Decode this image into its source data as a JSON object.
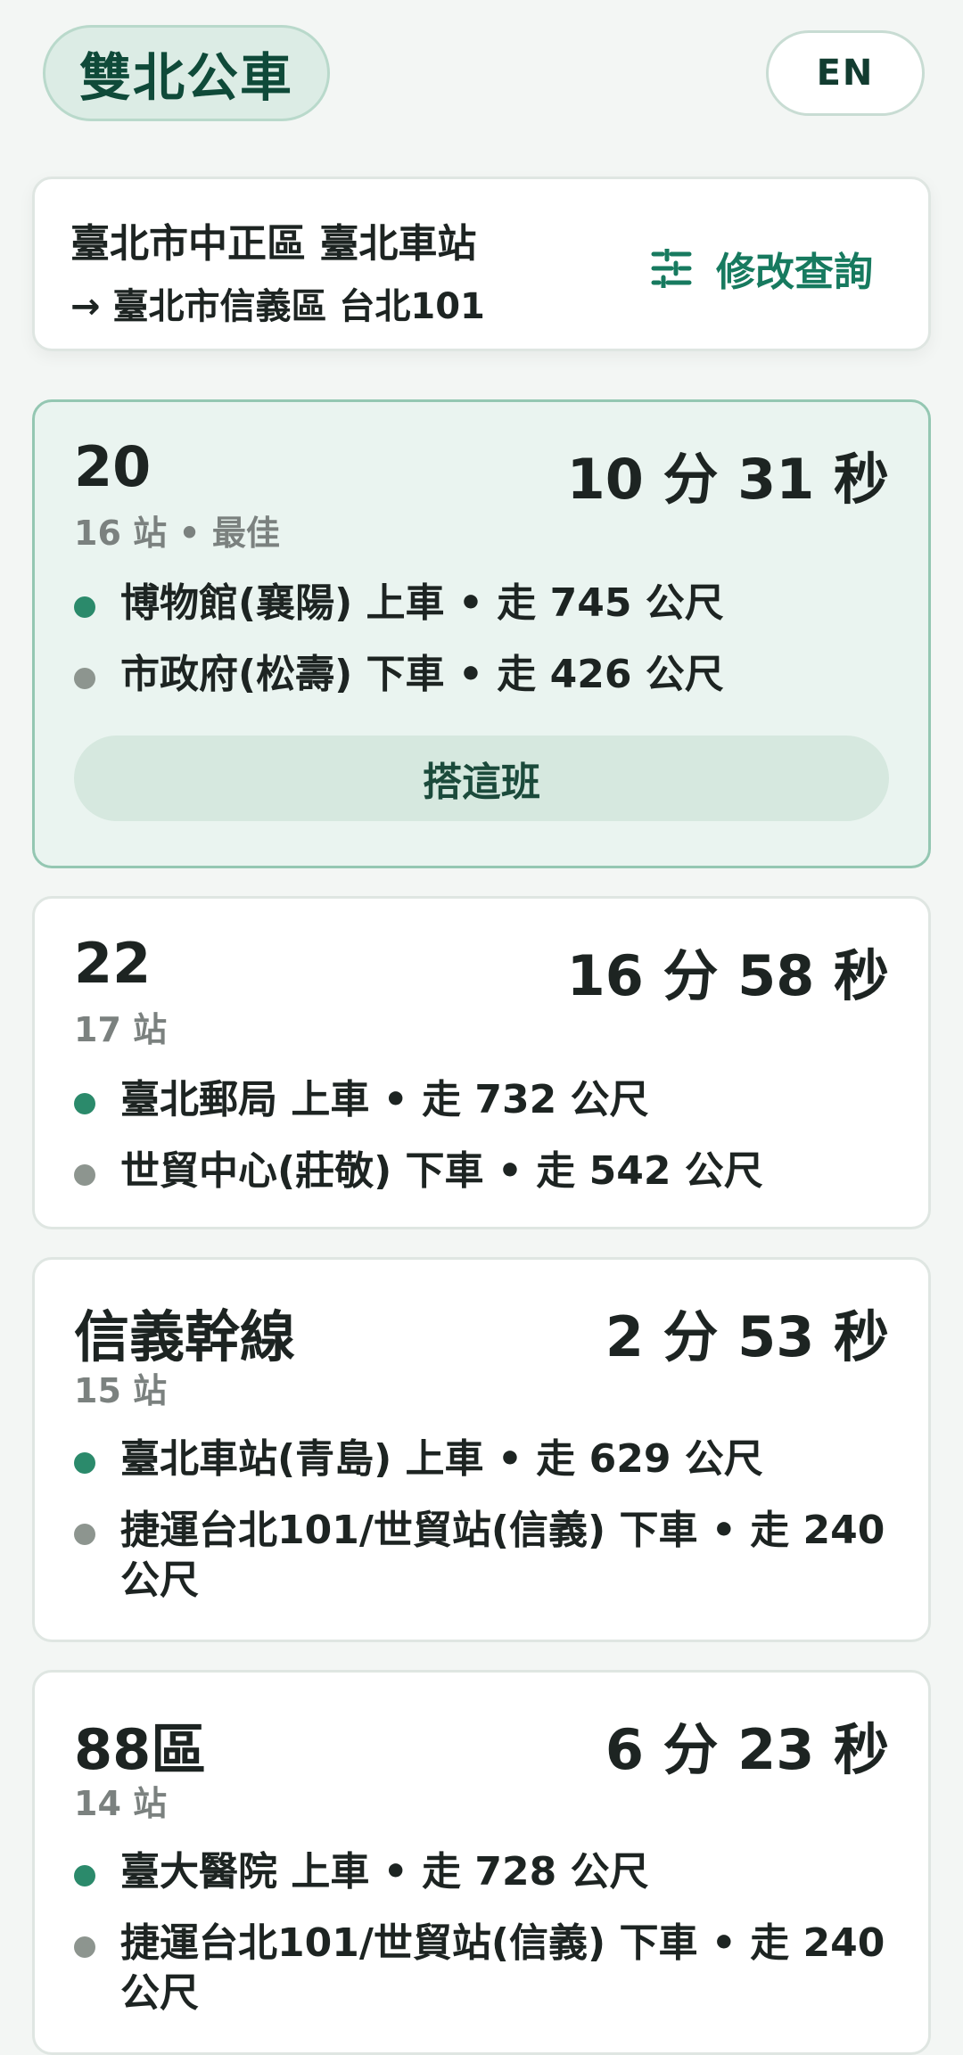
{
  "header": {
    "app_title": "雙北公車",
    "lang_button": "EN"
  },
  "query": {
    "from": "臺北市中正區 臺北車站",
    "to": "→ 臺北市信義區 台北101",
    "edit_label": "修改查詢",
    "edit_icon": "sliders-icon"
  },
  "routes": [
    {
      "number": "20",
      "time": "10 分 31 秒",
      "meta": "16 站 • 最佳",
      "board": "博物館(襄陽) 上車 • 走 745 公尺",
      "alight": "市政府(松壽) 下車 • 走 426 公尺",
      "action": "搭這班"
    },
    {
      "number": "22",
      "time": "16 分 58 秒",
      "meta": "17 站",
      "board": "臺北郵局 上車 • 走 732 公尺",
      "alight": "世貿中心(莊敬) 下車 • 走 542 公尺"
    },
    {
      "number": "信義幹線",
      "time": "2 分 53 秒",
      "meta": "15 站",
      "board": "臺北車站(青島) 上車 • 走 629 公尺",
      "alight": "捷運台北101/世貿站(信義) 下車 • 走 240 公尺"
    },
    {
      "number": "88區",
      "time": "6 分 23 秒",
      "meta": "14 站",
      "board": "臺大醫院 上車 • 走 728 公尺",
      "alight": "捷運台北101/世貿站(信義) 下車 • 走 240 公尺"
    }
  ],
  "colors": {
    "accent": "#177a5f",
    "board_dot": "#2b8a6b",
    "alight_dot": "#8d958f",
    "best_bg": "#eaf4f0"
  }
}
